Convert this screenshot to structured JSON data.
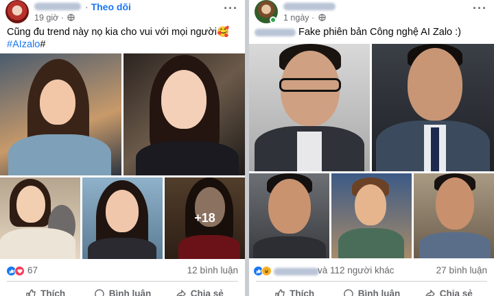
{
  "left_post": {
    "follow_label": "Theo dõi",
    "time": "19 giờ",
    "caption_line1": "Cũng đu trend này nọ kia cho vui với mọi người🥰",
    "hashtag": "#AIzalo",
    "hashtag_suffix": "#",
    "more_photos": "+18",
    "reaction_count": "67",
    "comments": "12 bình luận",
    "actions": {
      "like": "Thích",
      "comment": "Bình luận",
      "share": "Chia sẻ"
    }
  },
  "right_post": {
    "time": "1 ngày",
    "caption": "Fake phiên bản Công nghệ AI Zalo :)",
    "reaction_text": "và 112 người khác",
    "comments": "27 bình luận",
    "actions": {
      "like": "Thích",
      "comment": "Bình luận",
      "share": "Chia sẻ"
    }
  },
  "colors": {
    "link": "#1877f2",
    "secondary_text": "#65676b",
    "like": "#1877f2",
    "love": "#f33e58",
    "haha": "#f7b125",
    "divider": "#ced0d4"
  },
  "icons": [
    "globe-icon",
    "more-icon",
    "like-icon",
    "love-icon",
    "haha-icon",
    "thumb-icon",
    "comment-icon",
    "share-icon"
  ]
}
